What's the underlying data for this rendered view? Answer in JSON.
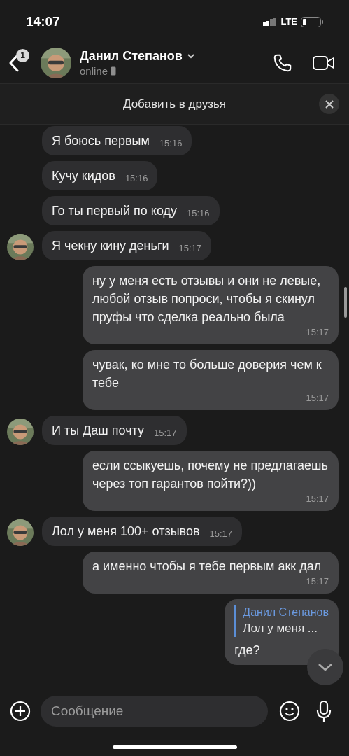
{
  "status_bar": {
    "time": "14:07",
    "network": "LTE"
  },
  "header": {
    "badge": "1",
    "name": "Данил Степанов",
    "status": "online"
  },
  "banner": {
    "label": "Добавить в друзья"
  },
  "messages": [
    {
      "kind": "in",
      "avatar": false,
      "text": "Я боюсь первым",
      "time": "15:16"
    },
    {
      "kind": "in",
      "avatar": false,
      "text": "Кучу кидов",
      "time": "15:16"
    },
    {
      "kind": "in",
      "avatar": false,
      "text": "Го ты первый по коду",
      "time": "15:16"
    },
    {
      "kind": "in",
      "avatar": true,
      "text": "Я чекну кину деньги",
      "time": "15:17"
    },
    {
      "kind": "out",
      "avatar": false,
      "text": "ну у меня есть отзывы и они не левые, любой отзыв попроси, чтобы я скинул пруфы что сделка реально была",
      "time": "15:17"
    },
    {
      "kind": "out",
      "avatar": false,
      "text": "чувак, ко мне то больше доверия чем к тебе",
      "time": "15:17"
    },
    {
      "kind": "in",
      "avatar": true,
      "text": "И ты Даш почту",
      "time": "15:17"
    },
    {
      "kind": "out",
      "avatar": false,
      "text": "если ссыкуешь, почему не предлагаешь через топ гарантов пойти?))",
      "time": "15:17"
    },
    {
      "kind": "in",
      "avatar": true,
      "text": "Лол у меня 100+ отзывов",
      "time": "15:17"
    },
    {
      "kind": "out",
      "avatar": false,
      "text": "а именно чтобы я тебе первым акк дал",
      "time": "15:17"
    },
    {
      "kind": "out",
      "avatar": false,
      "text": "где?",
      "reply": {
        "author": "Данил Степанов",
        "text": "Лол у меня ..."
      }
    }
  ],
  "composer": {
    "placeholder": "Сообщение"
  }
}
